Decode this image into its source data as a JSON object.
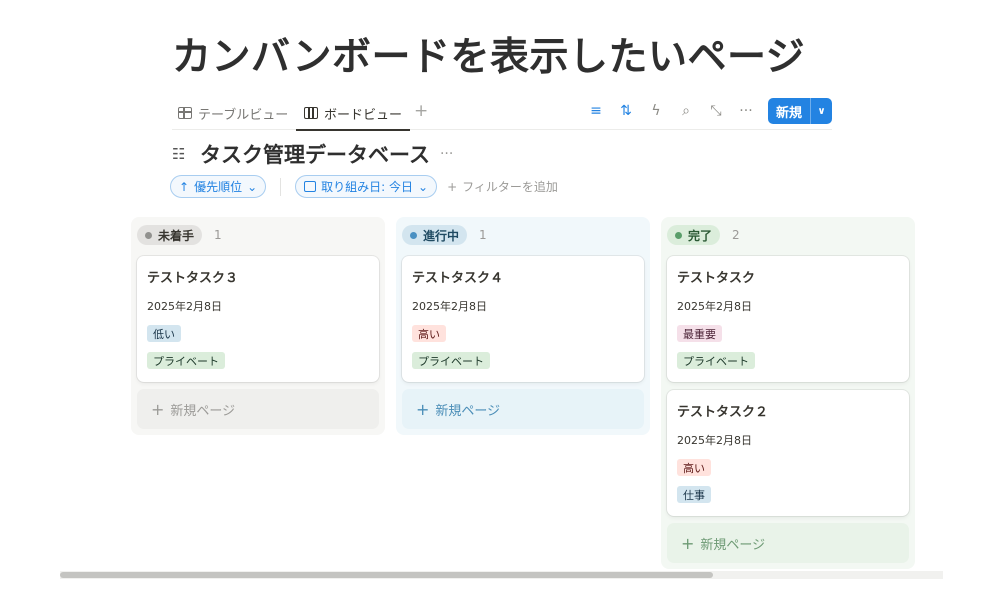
{
  "page": {
    "title": "カンバンボードを表示したいページ"
  },
  "views": {
    "tabs": [
      {
        "label": "テーブルビュー",
        "icon": "table-icon",
        "active": false
      },
      {
        "label": "ボードビュー",
        "icon": "board-icon",
        "active": true
      }
    ],
    "add_view_label": "+",
    "toolbar_icons": [
      "filter-icon",
      "sort-icon",
      "automation-icon",
      "search-icon",
      "expand-icon",
      "more-icon"
    ],
    "new_button": {
      "label": "新規",
      "dropdown": "∨"
    }
  },
  "database": {
    "icon": "checklist-icon",
    "title": "タスク管理データベース",
    "more": "···"
  },
  "filters": {
    "sort_chip": {
      "arrow": "↑",
      "label": "優先順位",
      "chevron": "⌄"
    },
    "date_chip": {
      "label": "取り組み日: 今日",
      "chevron": "⌄"
    },
    "add_filter": {
      "plus": "+",
      "label": "フィルターを追加"
    }
  },
  "board": {
    "columns": [
      {
        "status": "未着手",
        "count": "1",
        "cards": [
          {
            "title": "テストタスク３",
            "date": "2025年2月8日",
            "tags": [
              "低い",
              "プライベート"
            ]
          }
        ],
        "new_page": "新規ページ"
      },
      {
        "status": "進行中",
        "count": "1",
        "cards": [
          {
            "title": "テストタスク４",
            "date": "2025年2月8日",
            "tags": [
              "高い",
              "プライベート"
            ]
          }
        ],
        "new_page": "新規ページ"
      },
      {
        "status": "完了",
        "count": "2",
        "cards": [
          {
            "title": "テストタスク",
            "date": "2025年2月8日",
            "tags": [
              "最重要",
              "プライベート"
            ]
          },
          {
            "title": "テストタスク２",
            "date": "2025年2月8日",
            "tags": [
              "高い",
              "仕事"
            ]
          }
        ],
        "new_page": "新規ページ"
      }
    ]
  },
  "colors": {
    "accent": "#2383e2",
    "status_not_started": "#e3e2e0",
    "status_in_progress": "#d3e5ef",
    "status_done": "#dbeddb"
  },
  "scrollbar": {
    "horizontal_visible_fraction": 0.74
  }
}
